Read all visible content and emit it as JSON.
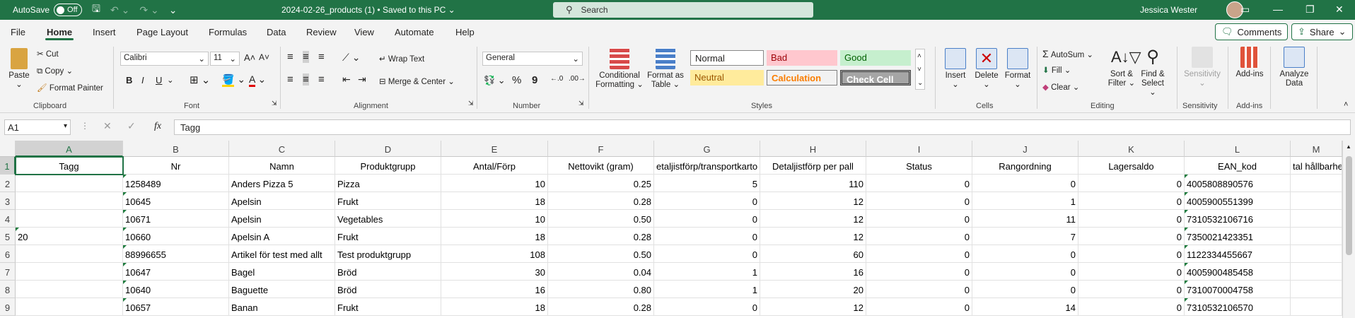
{
  "titlebar": {
    "autosave_label": "AutoSave",
    "autosave_state": "Off",
    "doc_title": "2024-02-26_products (1)  •  Saved to this PC  ⌄",
    "search_placeholder": "Search",
    "user_name": "Jessica Wester"
  },
  "menu": {
    "tabs": [
      "File",
      "Home",
      "Insert",
      "Page Layout",
      "Formulas",
      "Data",
      "Review",
      "View",
      "Automate",
      "Help"
    ],
    "comments_label": "Comments",
    "share_label": "Share"
  },
  "ribbon": {
    "clipboard": {
      "paste": "Paste",
      "cut": "Cut",
      "copy": "Copy",
      "format_painter": "Format Painter",
      "label": "Clipboard"
    },
    "font": {
      "name": "Calibri",
      "size": "11",
      "bold": "B",
      "italic": "I",
      "underline": "U",
      "label": "Font"
    },
    "alignment": {
      "wrap_text": "Wrap Text",
      "merge_center": "Merge & Center",
      "label": "Alignment"
    },
    "number": {
      "format": "General",
      "percent": "%",
      "comma": "9",
      "label": "Number"
    },
    "styles": {
      "conditional_formatting": "Conditional Formatting",
      "format_as_table": "Format as Table",
      "normal": "Normal",
      "bad": "Bad",
      "good": "Good",
      "neutral": "Neutral",
      "calculation": "Calculation",
      "check_cell": "Check Cell",
      "label": "Styles"
    },
    "cells": {
      "insert": "Insert",
      "delete": "Delete",
      "format": "Format",
      "label": "Cells"
    },
    "editing": {
      "autosum": "AutoSum",
      "fill": "Fill",
      "clear": "Clear",
      "sort_filter": "Sort & Filter",
      "find_select": "Find & Select",
      "label": "Editing"
    },
    "sensitivity": {
      "button": "Sensitivity",
      "label": "Sensitivity"
    },
    "addins": {
      "button": "Add-ins",
      "label": "Add-ins"
    },
    "analyze": {
      "button": "Analyze Data"
    }
  },
  "formula_bar": {
    "name_box": "A1",
    "fx": "fx",
    "content": "Tagg"
  },
  "grid": {
    "columns": [
      "A",
      "B",
      "C",
      "D",
      "E",
      "F",
      "G",
      "H",
      "I",
      "J",
      "K",
      "L",
      "M"
    ],
    "row_numbers": [
      "1",
      "2",
      "3",
      "4",
      "5",
      "6",
      "7",
      "8",
      "9"
    ],
    "header_row": [
      "Tagg",
      "Nr",
      "Namn",
      "Produktgrupp",
      "Antal/Förp",
      "Nettovikt (gram)",
      "etaljistförp/transportkarto",
      "Detaljistförp per pall",
      "Status",
      "Rangordning",
      "Lagersaldo",
      "EAN_kod",
      "tal hållbarhe"
    ],
    "rows": [
      [
        "",
        "1258489",
        "Anders Pizza 5",
        "Pizza",
        "10",
        "0.25",
        "5",
        "110",
        "0",
        "0",
        "0",
        "4005808890576",
        ""
      ],
      [
        "",
        "10645",
        "Apelsin",
        "Frukt",
        "18",
        "0.28",
        "0",
        "12",
        "0",
        "1",
        "0",
        "4005900551399",
        ""
      ],
      [
        "",
        "10671",
        "Apelsin",
        "Vegetables",
        "10",
        "0.50",
        "0",
        "12",
        "0",
        "11",
        "0",
        "7310532106716",
        ""
      ],
      [
        "20",
        "10660",
        "Apelsin A",
        "Frukt",
        "18",
        "0.28",
        "0",
        "12",
        "0",
        "7",
        "0",
        "7350021423351",
        ""
      ],
      [
        "",
        "88996655",
        "Artikel för test med allt",
        "Test produktgrupp",
        "108",
        "0.50",
        "0",
        "60",
        "0",
        "0",
        "0",
        "1122334455667",
        ""
      ],
      [
        "",
        "10647",
        "Bagel",
        "Bröd",
        "30",
        "0.04",
        "1",
        "16",
        "0",
        "0",
        "0",
        "4005900485458",
        ""
      ],
      [
        "",
        "10640",
        "Baguette",
        "Bröd",
        "16",
        "0.80",
        "1",
        "20",
        "0",
        "0",
        "0",
        "7310070004758",
        ""
      ],
      [
        "",
        "10657",
        "Banan",
        "Frukt",
        "18",
        "0.28",
        "0",
        "12",
        "0",
        "14",
        "0",
        "7310532106570",
        ""
      ]
    ]
  }
}
